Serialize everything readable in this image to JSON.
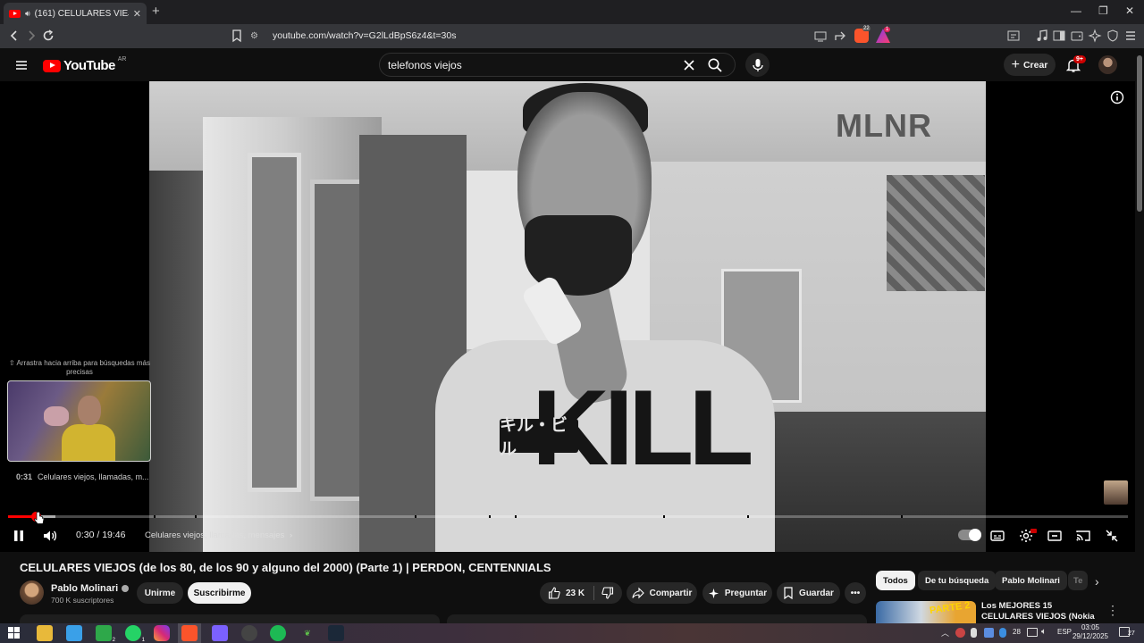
{
  "browser": {
    "tab_title": "(161) CELULARES VIEJOS (de",
    "tab_close": "✕",
    "new_tab": "+",
    "url": "youtube.com/watch?v=G2lLdBpS6z4&t=30s",
    "window_controls": [
      "—",
      "❐",
      "✕"
    ],
    "extension_badges": [
      "22",
      "1"
    ]
  },
  "youtube": {
    "logo_text": "YouTube",
    "country_code": "AR",
    "search_value": "telefonos viejos",
    "create_label": "Crear",
    "notifications_badge": "9+"
  },
  "player": {
    "watermark": "MLNR",
    "hint": "⇧ Arrastra hacia arriba para búsquedas más precisas",
    "preview_time": "0:31",
    "preview_chapter": "Celulares viejos, llamadas, m...",
    "time_current": "0:30",
    "time_sep": " / ",
    "time_total": "19:46",
    "chapter_title": "Celulares viejos, llamadas, mensajes",
    "chapter_arrow": "›",
    "shirt_text": "KILL",
    "shirt_japanese": "キル・ビル",
    "progress_fraction": 0.025,
    "buffer_fraction": 0.042,
    "settings_badge": "HD"
  },
  "video": {
    "title": "CELULARES VIEJOS (de los 80, de los 90 y alguno del 2000) (Parte 1) | PERDON, CENTENNIALS",
    "channel": "Pablo Molinari",
    "subscribers": "700 K suscriptores",
    "join_label": "Unirme",
    "subscribe_label": "Suscribirme",
    "likes": "23 K",
    "share_label": "Compartir",
    "ask_label": "Preguntar",
    "save_label": "Guardar",
    "more_label": "•••"
  },
  "sidebar": {
    "chips": [
      "Todos",
      "De tu búsqueda",
      "Pablo Molinari",
      "Te"
    ],
    "next_arrow": "›",
    "recommendation": {
      "thumb_text": "PARTE 2",
      "title": "Los MEJORES 15 CELULARES VIEJOS (Nokia 1100, Motorola...",
      "menu": "⋮"
    }
  },
  "taskbar": {
    "badges": [
      "2",
      "1"
    ],
    "temperature": "28",
    "language": "ESP",
    "time": "03:05",
    "date": "29/12/2025",
    "notifications": "27"
  },
  "colors": {
    "accent_red": "#ff0000",
    "background": "#0f0f0f",
    "chip_bg": "#272727"
  }
}
